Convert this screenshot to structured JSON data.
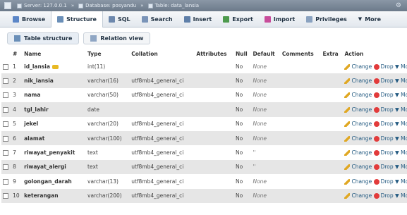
{
  "titlebar": {
    "server": "Server: 127.0.0.1",
    "database": "Database: posyandu",
    "table": "Table: data_lansia"
  },
  "tabs": [
    {
      "label": "Browse",
      "icon": "browse-icon",
      "color": "#5b86c7"
    },
    {
      "label": "Structure",
      "icon": "structure-icon",
      "color": "#6a8fb8",
      "active": true
    },
    {
      "label": "SQL",
      "icon": "sql-icon",
      "color": "#6d88ad"
    },
    {
      "label": "Search",
      "icon": "search-icon",
      "color": "#7a94b8"
    },
    {
      "label": "Insert",
      "icon": "insert-icon",
      "color": "#5e7fa9"
    },
    {
      "label": "Export",
      "icon": "export-icon",
      "color": "#4d9a4d"
    },
    {
      "label": "Import",
      "icon": "import-icon",
      "color": "#c84d9b"
    },
    {
      "label": "Privileges",
      "icon": "privileges-icon",
      "color": "#8aa2c0"
    },
    {
      "label": "More",
      "icon": "chevron-down-icon",
      "color": "#234"
    }
  ],
  "subtabs": [
    {
      "label": "Table structure",
      "active": true
    },
    {
      "label": "Relation view",
      "active": false
    }
  ],
  "columns": [
    "#",
    "Name",
    "Type",
    "Collation",
    "Attributes",
    "Null",
    "Default",
    "Comments",
    "Extra",
    "Action"
  ],
  "rows": [
    {
      "num": "1",
      "name": "id_lansia",
      "key": true,
      "type": "int(11)",
      "collation": "",
      "nul": "No",
      "default": "None"
    },
    {
      "num": "2",
      "name": "nik_lansia",
      "type": "varchar(16)",
      "collation": "utf8mb4_general_ci",
      "nul": "No",
      "default": "None"
    },
    {
      "num": "3",
      "name": "nama",
      "type": "varchar(50)",
      "collation": "utf8mb4_general_ci",
      "nul": "No",
      "default": "None"
    },
    {
      "num": "4",
      "name": "tgl_lahir",
      "type": "date",
      "collation": "",
      "nul": "No",
      "default": "None"
    },
    {
      "num": "5",
      "name": "jekel",
      "type": "varchar(20)",
      "collation": "utf8mb4_general_ci",
      "nul": "No",
      "default": "None"
    },
    {
      "num": "6",
      "name": "alamat",
      "type": "varchar(100)",
      "collation": "utf8mb4_general_ci",
      "nul": "No",
      "default": "None"
    },
    {
      "num": "7",
      "name": "riwayat_penyakit",
      "type": "text",
      "collation": "utf8mb4_general_ci",
      "nul": "No",
      "default": "''"
    },
    {
      "num": "8",
      "name": "riwayat_alergi",
      "type": "text",
      "collation": "utf8mb4_general_ci",
      "nul": "No",
      "default": "''"
    },
    {
      "num": "9",
      "name": "golongan_darah",
      "type": "varchar(13)",
      "collation": "utf8mb4_general_ci",
      "nul": "No",
      "default": "None"
    },
    {
      "num": "10",
      "name": "keterangan",
      "type": "varchar(200)",
      "collation": "utf8mb4_general_ci",
      "nul": "No",
      "default": "None"
    }
  ],
  "actions": {
    "change": "Change",
    "drop": "Drop",
    "more": "Mor"
  }
}
